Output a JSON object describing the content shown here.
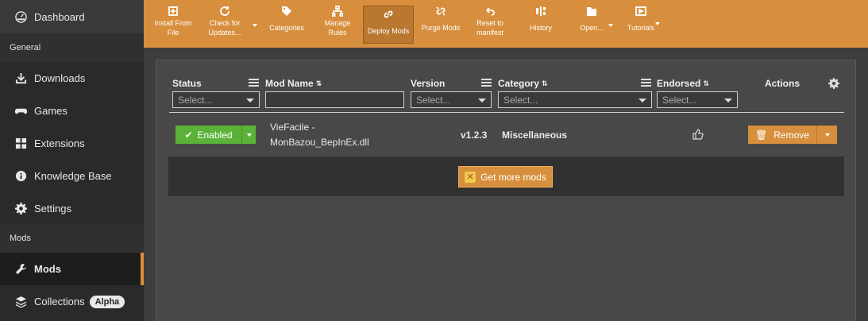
{
  "sidebar": {
    "dashboard": "Dashboard",
    "section_general": "General",
    "downloads": "Downloads",
    "games": "Games",
    "extensions": "Extensions",
    "knowledge_base": "Knowledge Base",
    "settings": "Settings",
    "section_mods": "Mods",
    "mods": "Mods",
    "collections": "Collections",
    "collections_badge": "Alpha"
  },
  "toolbar": {
    "install_from_file_l1": "Install From",
    "install_from_file_l2": "File",
    "check_updates_l1": "Check for",
    "check_updates_l2": "Updates...",
    "categories": "Categories",
    "manage_rules_l1": "Manage",
    "manage_rules_l2": "Rules",
    "deploy_mods": "Deploy Mods",
    "purge_mods": "Purge Mods",
    "reset_manifest_l1": "Reset to",
    "reset_manifest_l2": "manifest",
    "history": "History",
    "open": "Open...",
    "tutorials": "Tutorials"
  },
  "table": {
    "headers": {
      "status": "Status",
      "mod_name": "Mod Name",
      "version": "Version",
      "category": "Category",
      "endorsed": "Endorsed",
      "actions": "Actions"
    },
    "filter_placeholder": "Select...",
    "rows": [
      {
        "status": "Enabled",
        "name_l1": "VieFacile -",
        "name_l2": "MonBazou_BepInEx.dll",
        "version": "v1.2.3",
        "category": "Miscellaneous",
        "action": "Remove"
      }
    ],
    "get_more_mods": "Get more mods"
  }
}
